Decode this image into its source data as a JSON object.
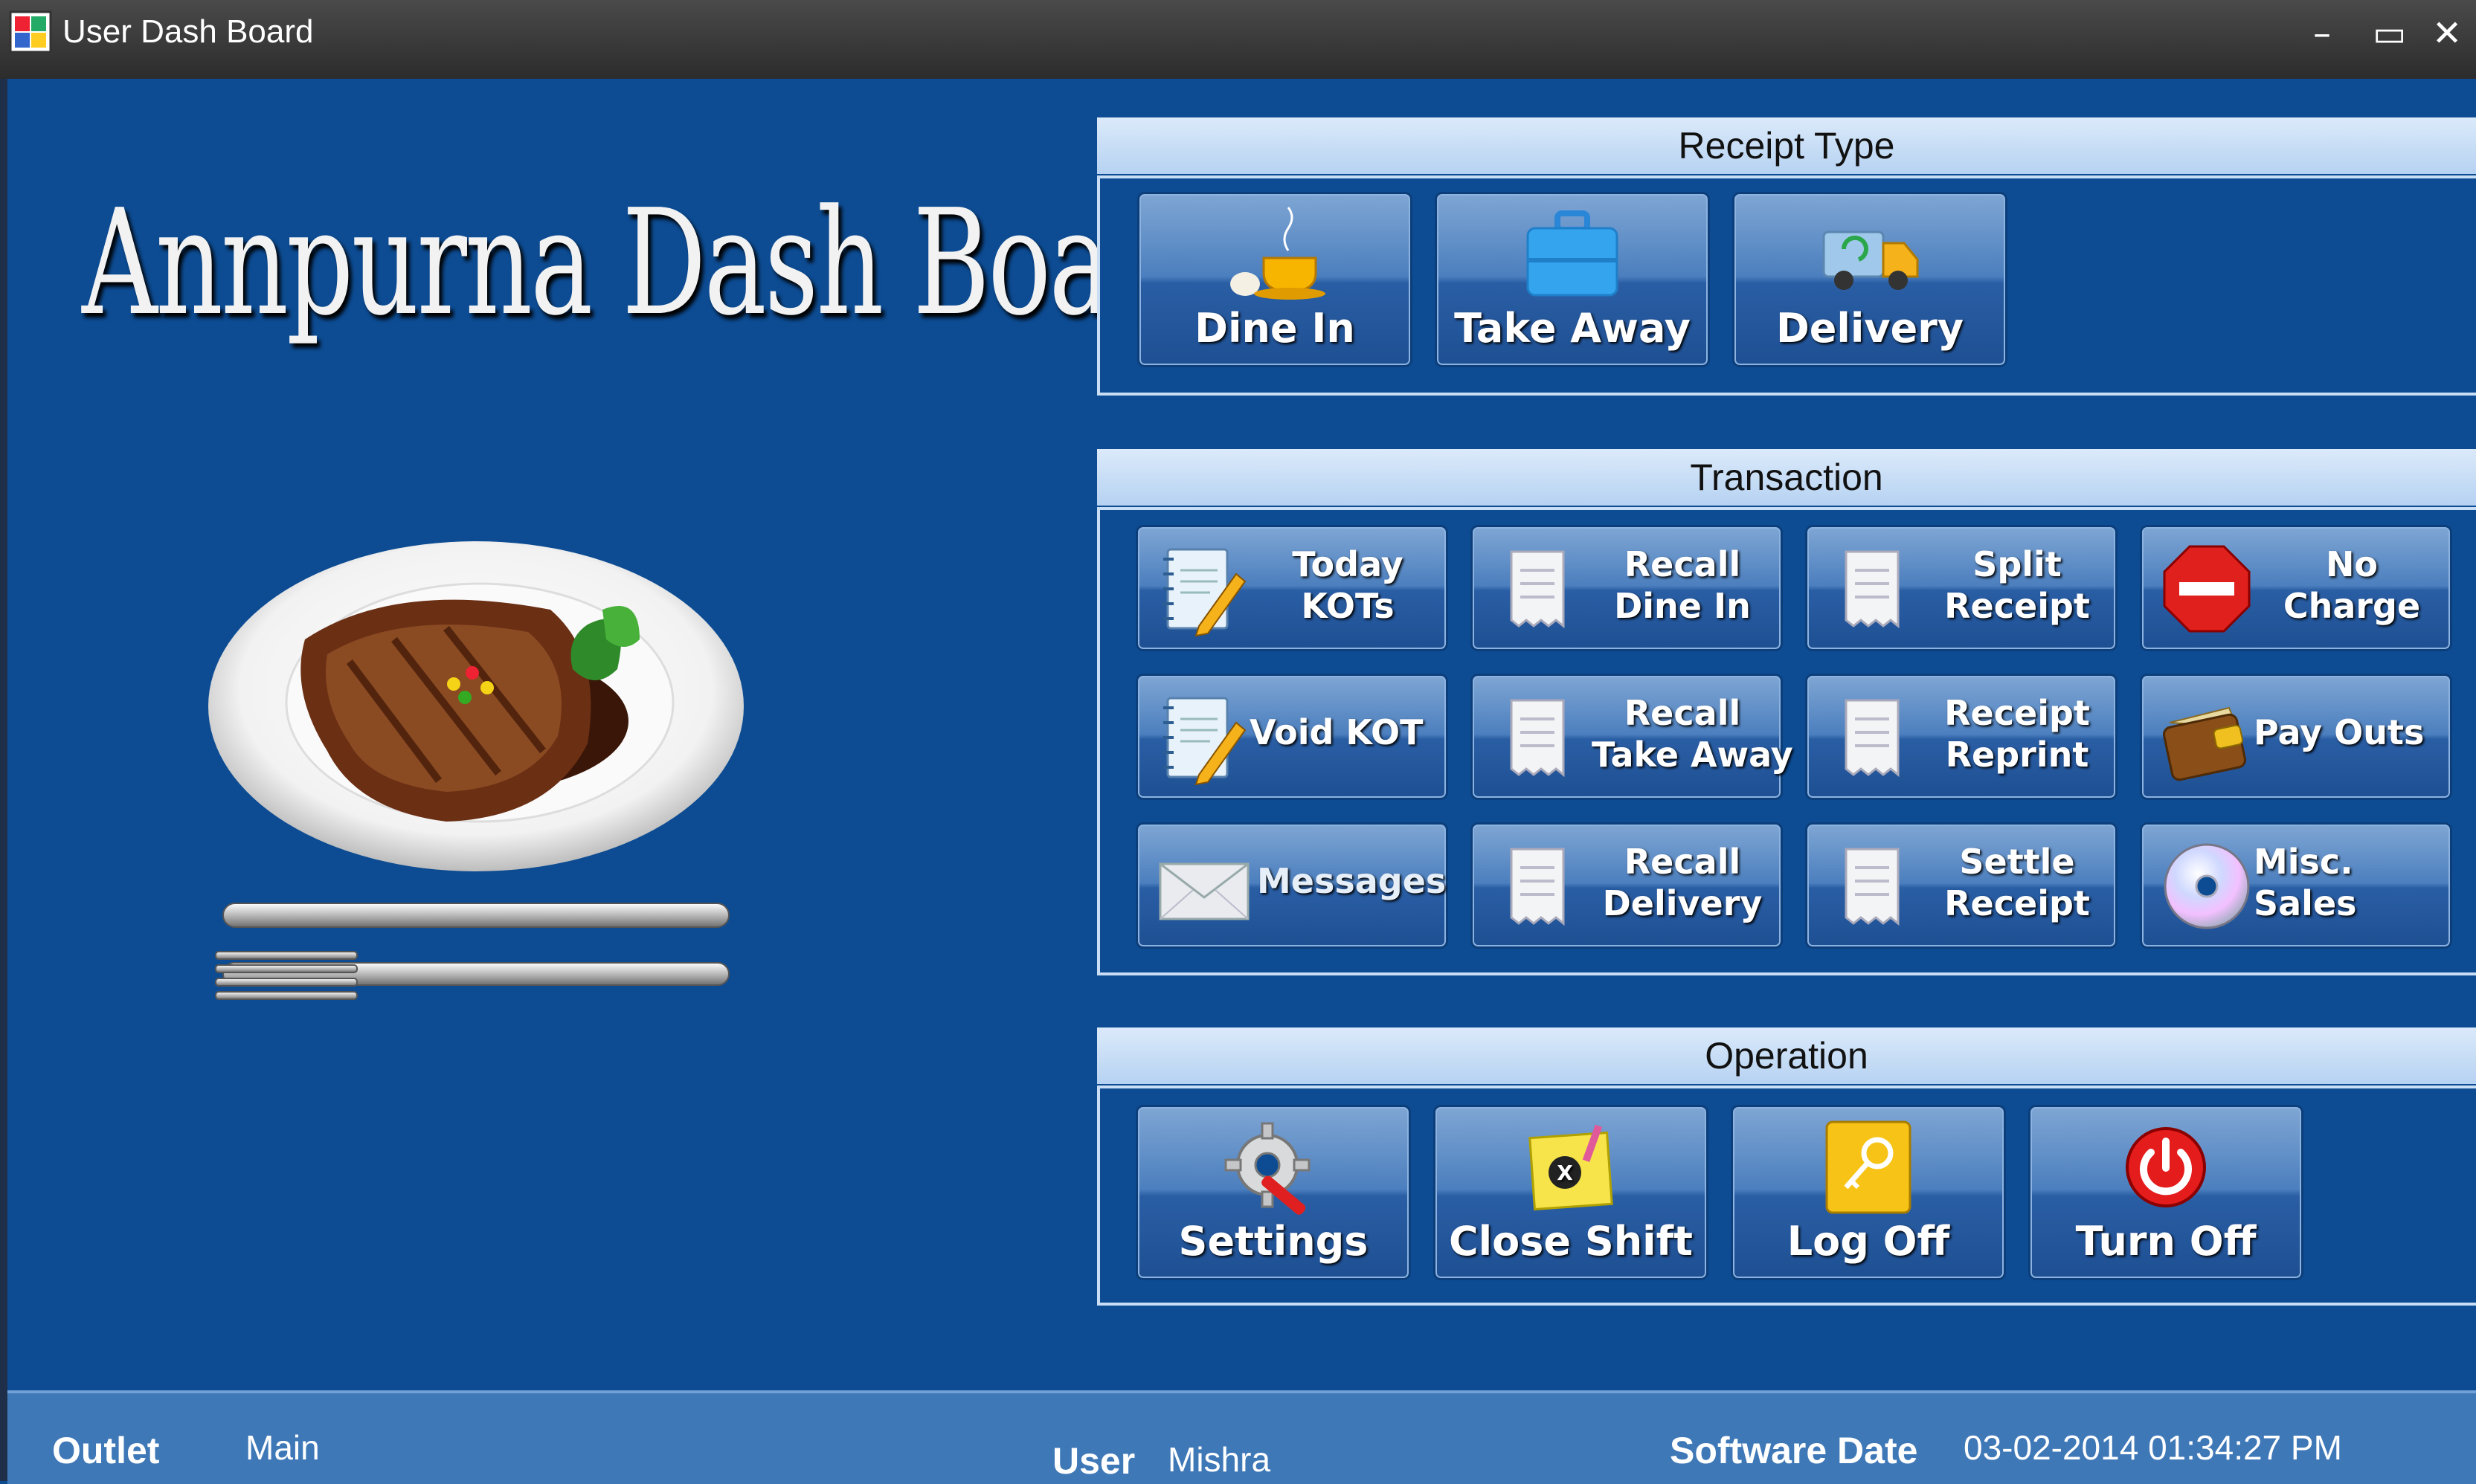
{
  "window": {
    "title": "User Dash Board",
    "controls": {
      "minimize": "–",
      "maximize": "▭",
      "close": "✕"
    }
  },
  "logo": {
    "text": "Annpurna Dash Board"
  },
  "receipt_type": {
    "header": "Receipt Type",
    "buttons": [
      {
        "label": "Dine In",
        "icon": "coffee-cup-icon"
      },
      {
        "label": "Take Away",
        "icon": "briefcase-icon"
      },
      {
        "label": "Delivery",
        "icon": "delivery-truck-icon"
      }
    ]
  },
  "transaction": {
    "header": "Transaction",
    "buttons": [
      {
        "line1": "Today",
        "line2": "KOTs",
        "icon": "notepad-pencil-icon"
      },
      {
        "line1": "Recall",
        "line2": "Dine In",
        "icon": "receipt-icon"
      },
      {
        "line1": "Split",
        "line2": "Receipt",
        "icon": "receipt-icon"
      },
      {
        "line1": "No",
        "line2": "Charge",
        "icon": "no-entry-icon"
      },
      {
        "line1": "Void KOT",
        "line2": "",
        "icon": "notepad-pencil-icon"
      },
      {
        "line1": "Recall",
        "line2": "Take Away",
        "icon": "receipt-icon"
      },
      {
        "line1": "Receipt",
        "line2": "Reprint",
        "icon": "receipt-icon"
      },
      {
        "line1": "Pay Outs",
        "line2": "",
        "icon": "wallet-icon"
      },
      {
        "line1": "Messages",
        "line2": "",
        "icon": "envelope-icon"
      },
      {
        "line1": "Recall",
        "line2": "Delivery",
        "icon": "receipt-icon"
      },
      {
        "line1": "Settle",
        "line2": "Receipt",
        "icon": "receipt-icon"
      },
      {
        "line1": "Misc.",
        "line2": "Sales",
        "icon": "cd-disc-icon"
      }
    ]
  },
  "operation": {
    "header": "Operation",
    "buttons": [
      {
        "label": "Settings",
        "icon": "gear-wrench-icon"
      },
      {
        "label": "Close Shift",
        "icon": "sticky-note-close-icon"
      },
      {
        "label": "Log Off",
        "icon": "key-icon"
      },
      {
        "label": "Turn Off",
        "icon": "power-icon"
      }
    ]
  },
  "status": {
    "outlet_label": "Outlet",
    "outlet_value": "Main",
    "user_label": "User",
    "user_value": "Mishra",
    "date_label": "Software Date",
    "date_value": "03-02-2014 01:34:27 PM"
  },
  "colors": {
    "background": "#0d4c93",
    "header": "#c9def5",
    "status_bar": "#3f78b7"
  }
}
